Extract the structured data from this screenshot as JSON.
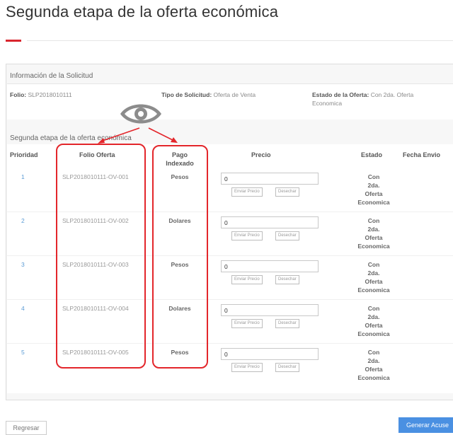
{
  "page": {
    "title": "Segunda etapa de la oferta económica"
  },
  "info": {
    "heading": "Información de la Solicitud",
    "folio_label": "Folio:",
    "folio_value": "SLP2018010111",
    "tipo_label": "Tipo de Solicitud:",
    "tipo_value": "Oferta de Venta",
    "estado_label": "Estado de la Oferta:",
    "estado_value_line1": "Con 2da. Oferta",
    "estado_value_line2": "Economica"
  },
  "section": {
    "heading": "Segunda etapa de la oferta económica"
  },
  "table": {
    "columns": {
      "prioridad": "Prioridad",
      "folio": "Folio Oferta",
      "pago_line1": "Pago",
      "pago_line2": "Indexado",
      "precio": "Precio",
      "estado": "Estado",
      "fecha": "Fecha Envio"
    },
    "send_label": "Enviar Precio",
    "discard_label": "Desechar",
    "rows": [
      {
        "prioridad": "1",
        "folio": "SLP2018010111-OV-001",
        "pago": "Pesos",
        "precio": "0",
        "estado": [
          "Con",
          "2da.",
          "Oferta",
          "Economica"
        ]
      },
      {
        "prioridad": "2",
        "folio": "SLP2018010111-OV-002",
        "pago": "Dolares",
        "precio": "0",
        "estado": [
          "Con",
          "2da.",
          "Oferta",
          "Economica"
        ]
      },
      {
        "prioridad": "3",
        "folio": "SLP2018010111-OV-003",
        "pago": "Pesos",
        "precio": "0",
        "estado": [
          "Con",
          "2da.",
          "Oferta",
          "Economica"
        ]
      },
      {
        "prioridad": "4",
        "folio": "SLP2018010111-OV-004",
        "pago": "Dolares",
        "precio": "0",
        "estado": [
          "Con",
          "2da.",
          "Oferta",
          "Economica"
        ]
      },
      {
        "prioridad": "5",
        "folio": "SLP2018010111-OV-005",
        "pago": "Pesos",
        "precio": "0",
        "estado": [
          "Con",
          "2da.",
          "Oferta",
          "Economica"
        ]
      }
    ]
  },
  "actions": {
    "back_label": "Regresar",
    "acuse_label": "Generar Acuse"
  },
  "colors": {
    "accent": "#d9262e",
    "annotation": "#e3262b",
    "primary_button": "#4a90e2",
    "link": "#5b9bd5"
  },
  "icons": {
    "annotation_eye": "eye-icon"
  }
}
